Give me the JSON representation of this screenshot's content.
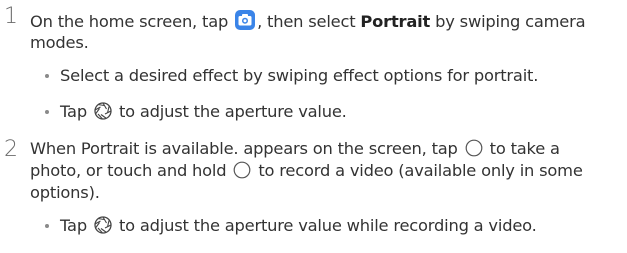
{
  "steps": [
    {
      "number": "1",
      "line1_a": "On the home screen, tap",
      "line1_b": ", then select",
      "line1_bold": "Portrait",
      "line1_c": "by swiping camera",
      "line2": "modes.",
      "bullets": [
        {
          "text": "Select a desired effect by swiping effect options for portrait."
        },
        {
          "pre": "Tap",
          "post": "to adjust the aperture value."
        }
      ]
    },
    {
      "number": "2",
      "line1_a": "When Portrait is available. appears on the screen, tap",
      "line1_b": "to take a",
      "line2_a": "photo, or touch and hold",
      "line2_b": "to record a video (available only in some",
      "line3": "options).",
      "bullets": [
        {
          "pre": "Tap",
          "post": "to adjust the aperture value while recording a video."
        }
      ]
    }
  ],
  "icons": {
    "camera_app": "camera-app-icon",
    "aperture": "aperture-icon",
    "shutter": "shutter-button-icon"
  },
  "colors": {
    "camera_icon_bg": "#3a84e8",
    "text": "#333333",
    "step_number": "#6b6b6b"
  }
}
